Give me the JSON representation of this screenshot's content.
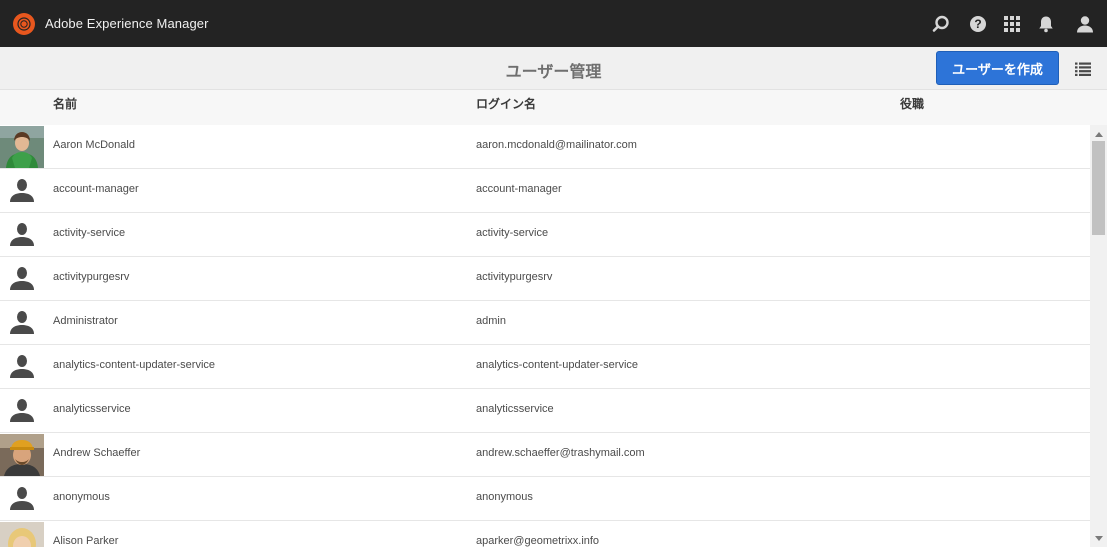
{
  "app": {
    "title": "Adobe Experience Manager"
  },
  "topbar": {
    "icons": [
      "search-icon",
      "help-icon",
      "apps-grid-icon",
      "bell-icon",
      "user-icon"
    ]
  },
  "actionbar": {
    "title": "ユーザー管理",
    "create_button": "ユーザーを作成",
    "view_icon": "list-view-icon"
  },
  "columns": {
    "name": "名前",
    "login": "ログイン名",
    "role": "役職"
  },
  "users": [
    {
      "name": "Aaron McDonald",
      "login": "aaron.mcdonald@mailinator.com",
      "role": "",
      "avatar": "photo-green"
    },
    {
      "name": "account-manager",
      "login": "account-manager",
      "role": "",
      "avatar": "silhouette"
    },
    {
      "name": "activity-service",
      "login": "activity-service",
      "role": "",
      "avatar": "silhouette"
    },
    {
      "name": "activitypurgesrv",
      "login": "activitypurgesrv",
      "role": "",
      "avatar": "silhouette"
    },
    {
      "name": "Administrator",
      "login": "admin",
      "role": "",
      "avatar": "silhouette"
    },
    {
      "name": "analytics-content-updater-service",
      "login": "analytics-content-updater-service",
      "role": "",
      "avatar": "silhouette"
    },
    {
      "name": "analyticsservice",
      "login": "analyticsservice",
      "role": "",
      "avatar": "silhouette"
    },
    {
      "name": "Andrew Schaeffer",
      "login": "andrew.schaeffer@trashymail.com",
      "role": "",
      "avatar": "photo-cap"
    },
    {
      "name": "anonymous",
      "login": "anonymous",
      "role": "",
      "avatar": "silhouette"
    },
    {
      "name": "Alison Parker",
      "login": "aparker@geometrixx.info",
      "role": "",
      "avatar": "photo-blonde"
    }
  ],
  "colors": {
    "topbar": "#232323",
    "brand_accent": "#e8571e",
    "primary_button": "#2d74d8"
  }
}
